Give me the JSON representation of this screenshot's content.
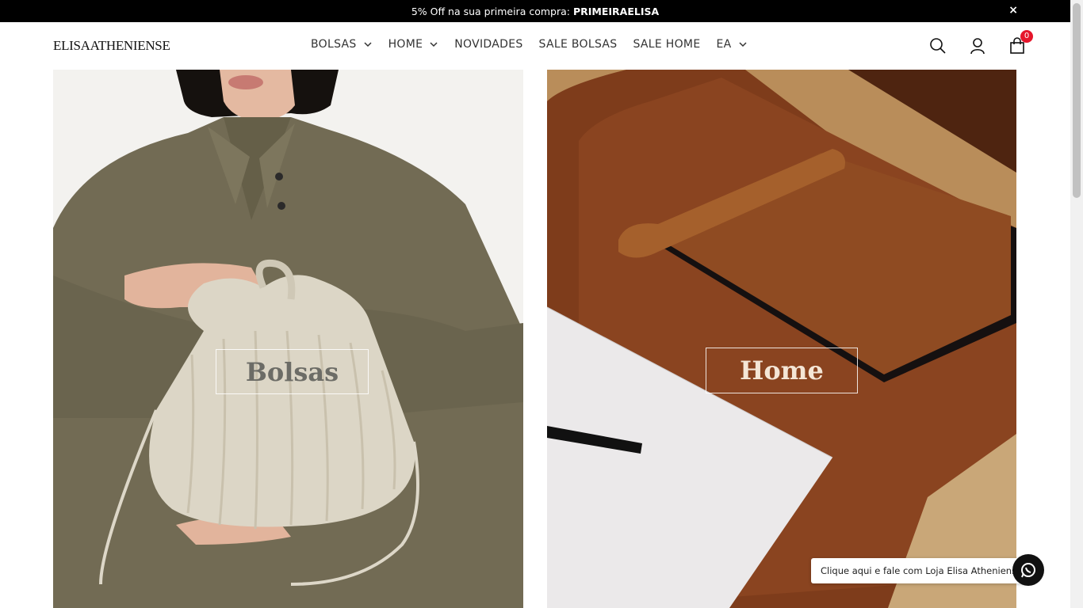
{
  "announcement": {
    "text": "5% Off na sua primeira compra:",
    "code": "PRIMEIRAELISA",
    "close": "×"
  },
  "header": {
    "logo": "ELISAATHENIENSE",
    "nav": [
      {
        "label": "BOLSAS",
        "has_dropdown": true
      },
      {
        "label": "HOME",
        "has_dropdown": true
      },
      {
        "label": "NOVIDADES",
        "has_dropdown": false
      },
      {
        "label": "SALE BOLSAS",
        "has_dropdown": false
      },
      {
        "label": "SALE HOME",
        "has_dropdown": false
      },
      {
        "label": "EA",
        "has_dropdown": true
      }
    ],
    "icons": [
      "search-icon",
      "user-icon",
      "shopping-bag-icon"
    ],
    "cart_count": "0"
  },
  "panels": {
    "left": {
      "label": "Bolsas",
      "image": "model-holding-pleated-bag"
    },
    "right": {
      "label": "Home",
      "image": "leather-desk-pad"
    }
  },
  "whatsapp": {
    "text": "Clique aqui e fale com Loja Elisa Atheniense",
    "icon": "whatsapp-icon"
  },
  "colors": {
    "announcement_bg": "#000000",
    "badge": "#e5162b",
    "leather": "#7a3b1c"
  }
}
